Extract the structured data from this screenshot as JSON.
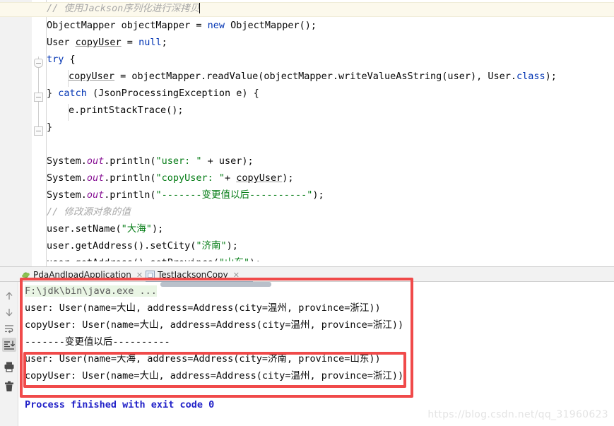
{
  "editor": {
    "caret_line_index": 0,
    "lines": [
      {
        "indent": 0,
        "highlight": true,
        "tokens": [
          {
            "type": "cmt",
            "text": "// 使用Jackson序列化进行深拷贝"
          },
          {
            "type": "caret",
            "text": ""
          }
        ]
      },
      {
        "indent": 0,
        "tokens": [
          {
            "type": "plain",
            "text": "ObjectMapper objectMapper = "
          },
          {
            "type": "kw",
            "text": "new"
          },
          {
            "type": "plain",
            "text": " ObjectMapper();"
          }
        ]
      },
      {
        "indent": 0,
        "tokens": [
          {
            "type": "plain",
            "text": "User "
          },
          {
            "type": "var",
            "text": "copyUser"
          },
          {
            "type": "plain",
            "text": " = "
          },
          {
            "type": "kw",
            "text": "null"
          },
          {
            "type": "plain",
            "text": ";"
          }
        ]
      },
      {
        "indent": 0,
        "tokens": [
          {
            "type": "kw",
            "text": "try"
          },
          {
            "type": "plain",
            "text": " {"
          }
        ]
      },
      {
        "indent": 1,
        "tokens": [
          {
            "type": "var",
            "text": "copyUser"
          },
          {
            "type": "plain",
            "text": " = objectMapper.readValue(objectMapper.writeValueAsString(user), User."
          },
          {
            "type": "kw",
            "text": "class"
          },
          {
            "type": "plain",
            "text": ");"
          }
        ]
      },
      {
        "indent": 0,
        "tokens": [
          {
            "type": "plain",
            "text": "} "
          },
          {
            "type": "kw",
            "text": "catch"
          },
          {
            "type": "plain",
            "text": " (JsonProcessingException e) {"
          }
        ]
      },
      {
        "indent": 1,
        "tokens": [
          {
            "type": "plain",
            "text": "e.printStackTrace();"
          }
        ]
      },
      {
        "indent": 0,
        "tokens": [
          {
            "type": "plain",
            "text": "}"
          }
        ]
      },
      {
        "indent": 0,
        "tokens": []
      },
      {
        "indent": 0,
        "tokens": [
          {
            "type": "plain",
            "text": "System."
          },
          {
            "type": "field",
            "text": "out"
          },
          {
            "type": "plain",
            "text": ".println("
          },
          {
            "type": "str",
            "text": "\"user: \""
          },
          {
            "type": "plain",
            "text": " + user);"
          }
        ]
      },
      {
        "indent": 0,
        "tokens": [
          {
            "type": "plain",
            "text": "System."
          },
          {
            "type": "field",
            "text": "out"
          },
          {
            "type": "plain",
            "text": ".println("
          },
          {
            "type": "str",
            "text": "\"copyUser: \""
          },
          {
            "type": "plain",
            "text": "+ "
          },
          {
            "type": "var",
            "text": "copyUser"
          },
          {
            "type": "plain",
            "text": ");"
          }
        ]
      },
      {
        "indent": 0,
        "tokens": [
          {
            "type": "plain",
            "text": "System."
          },
          {
            "type": "field",
            "text": "out"
          },
          {
            "type": "plain",
            "text": ".println("
          },
          {
            "type": "str",
            "text": "\"-------变更值以后----------\""
          },
          {
            "type": "plain",
            "text": ");"
          }
        ]
      },
      {
        "indent": 0,
        "tokens": [
          {
            "type": "cmt",
            "text": "// 修改源对象的值"
          }
        ]
      },
      {
        "indent": 0,
        "tokens": [
          {
            "type": "plain",
            "text": "user.setName("
          },
          {
            "type": "str",
            "text": "\"大海\""
          },
          {
            "type": "plain",
            "text": ");"
          }
        ]
      },
      {
        "indent": 0,
        "tokens": [
          {
            "type": "plain",
            "text": "user.getAddress().setCity("
          },
          {
            "type": "str",
            "text": "\"济南\""
          },
          {
            "type": "plain",
            "text": ");"
          }
        ]
      },
      {
        "indent": 0,
        "clipped": true,
        "tokens": [
          {
            "type": "plain",
            "text": "user.getAddress().setProvince("
          },
          {
            "type": "str",
            "text": "\"山东\""
          },
          {
            "type": "plain",
            "text": ");"
          }
        ]
      }
    ]
  },
  "run_panel": {
    "tabs": [
      {
        "label": "PdaAndIpadApplication",
        "icon": "spring-boot-icon",
        "close": "✕",
        "selected": false
      },
      {
        "label": "TestJacksonCopy",
        "icon": "java-class-icon",
        "close": "✕",
        "selected": true
      }
    ],
    "toolbar": [
      {
        "name": "scroll-up-button",
        "icon": "arrow-up-icon",
        "active": false
      },
      {
        "name": "scroll-down-button",
        "icon": "arrow-down-icon",
        "active": false
      },
      {
        "name": "soft-wrap-button",
        "icon": "soft-wrap-icon",
        "active": false
      },
      {
        "name": "scroll-to-end-button",
        "icon": "scroll-to-end-icon",
        "active": true
      },
      {
        "name": "print-button",
        "icon": "printer-icon",
        "active": false
      },
      {
        "name": "clear-all-button",
        "icon": "trash-icon",
        "active": false
      }
    ],
    "console": {
      "command": "F:\\jdk\\bin\\java.exe ...",
      "lines": [
        "user: User(name=大山, address=Address(city=温州, province=浙江))",
        "copyUser: User(name=大山, address=Address(city=温州, province=浙江))",
        "-------变更值以后----------",
        "user: User(name=大海, address=Address(city=济南, province=山东))",
        "copyUser: User(name=大山, address=Address(city=温州, province=浙江))"
      ],
      "exit_message": "Process finished with exit code 0"
    }
  },
  "annotations": {
    "outer_box_color": "#f04a4a",
    "inner_box_color": "#f04a4a"
  },
  "watermark": "https://blog.csdn.net/qq_31960623"
}
